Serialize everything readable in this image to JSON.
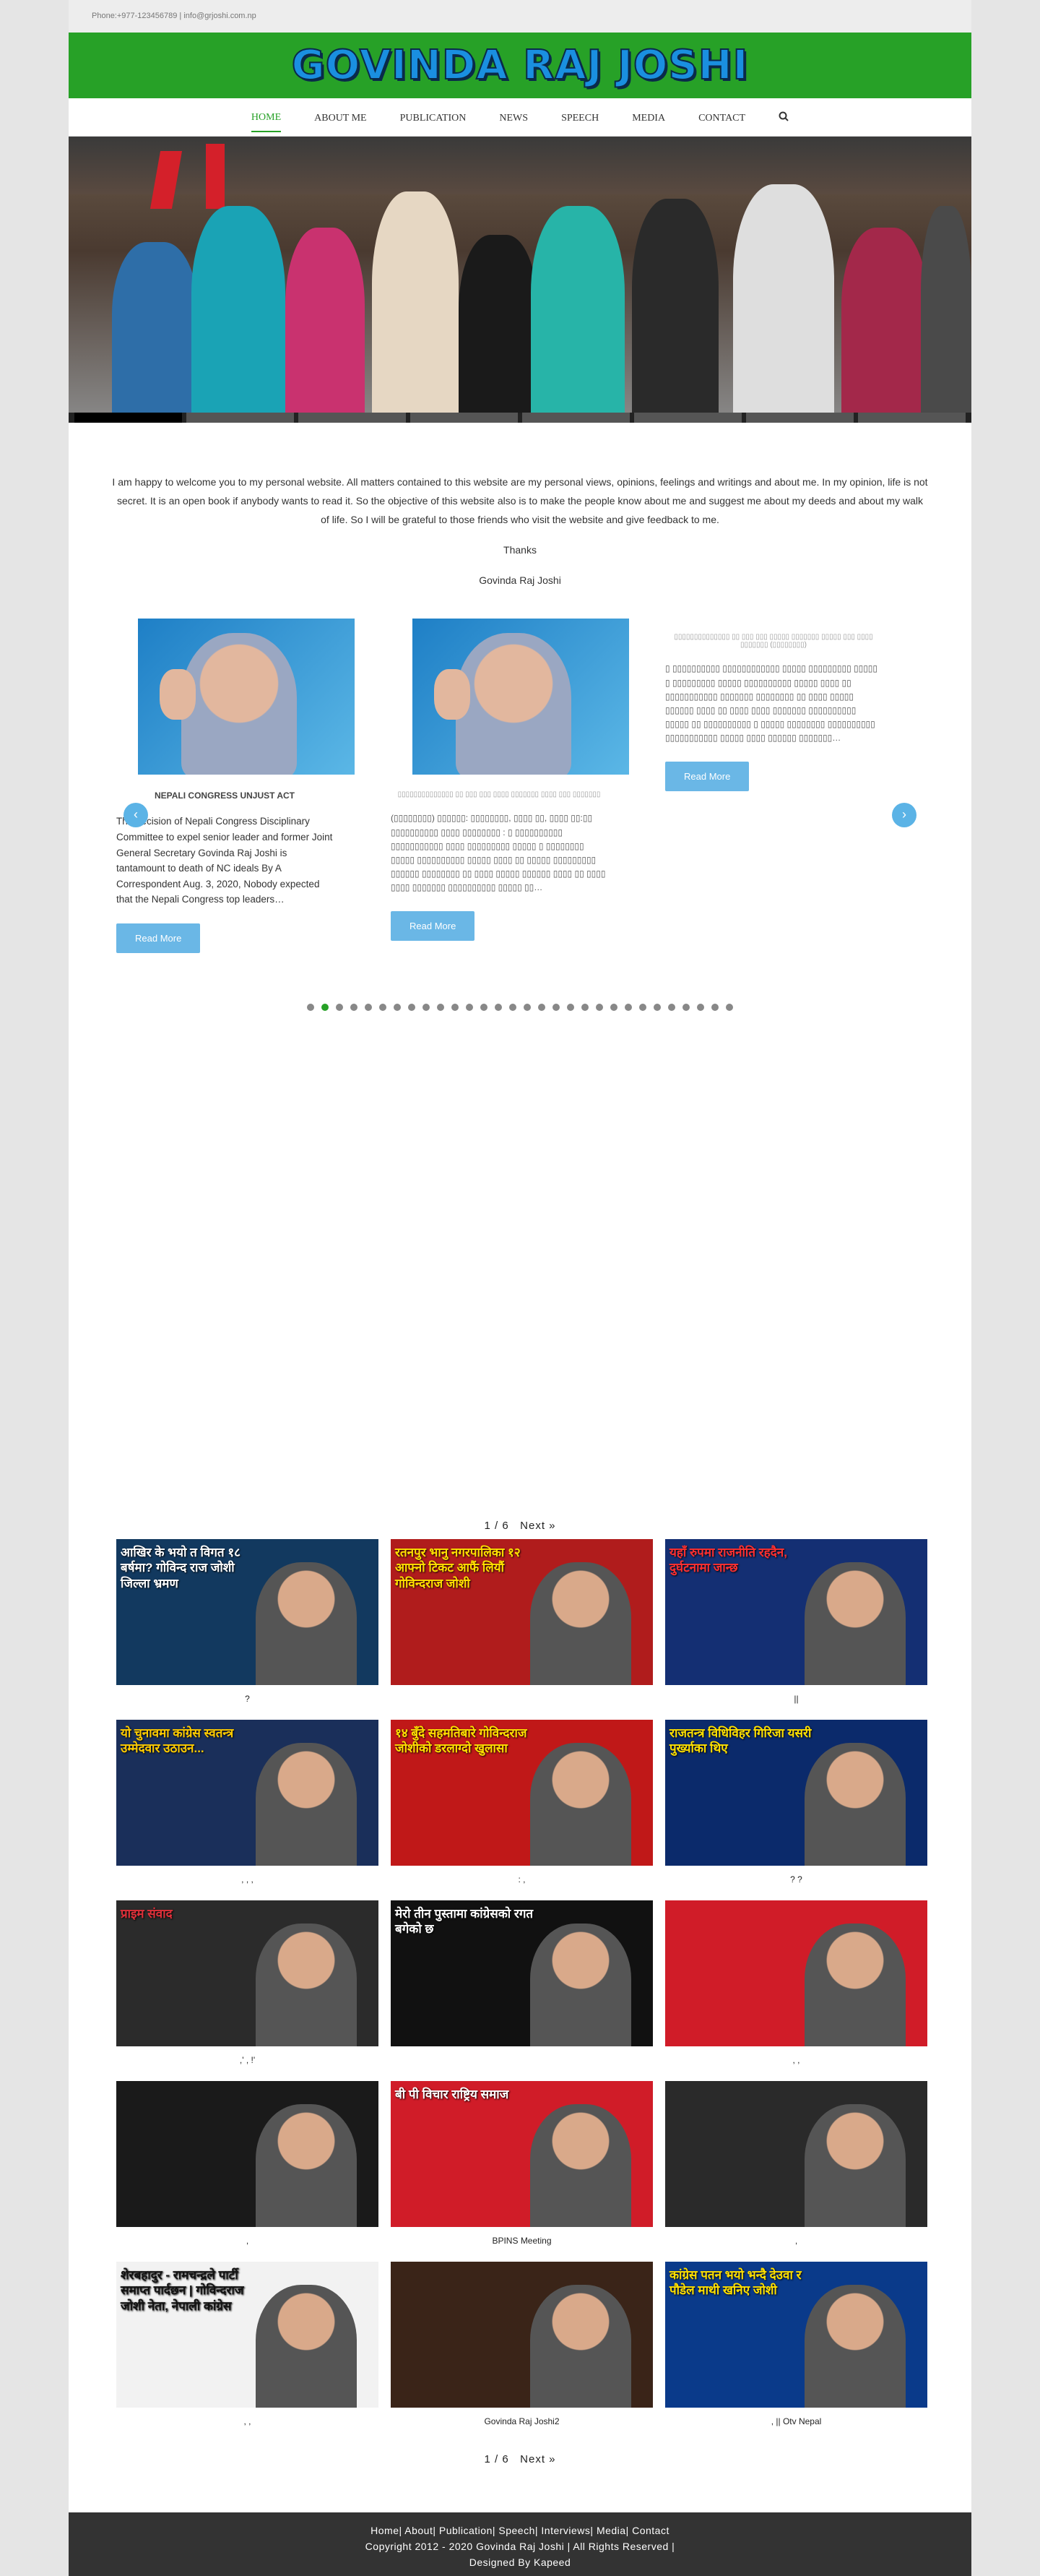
{
  "topbar": {
    "contact": "Phone:+977-123456789  |  info@grjoshi.com.np"
  },
  "header": {
    "logo_text": "GOVINDA RAJ JOSHI"
  },
  "nav": {
    "items": [
      "HOME",
      "ABOUT ME",
      "PUBLICATION",
      "NEWS",
      "SPEECH",
      "MEDIA",
      "CONTACT"
    ],
    "search_icon": "search-icon"
  },
  "intro": {
    "paragraph": "I am happy to welcome you to my personal website. All matters contained to this website are my personal views, opinions, feelings and writings and about me. In my opinion, life is not secret. It is an open book if anybody wants to read it. So the objective of this website also is to make the people know about me and suggest me about my deeds and about my walk of life. So I will be grateful to those friends who visit the website and give feedback to me.",
    "thanks": "Thanks",
    "signature": "Govinda Raj Joshi"
  },
  "carousel": {
    "cards": [
      {
        "title": "NEPALI CONGRESS UNJUST ACT",
        "text": "The decision of Nepali Congress Disciplinary Committee to expel senior leader and former Joint General Secretary Govinda Raj Joshi is tantamount to death of NC ideals By A Correspondent Aug. 3, 2020, Nobody expected that the Nepali Congress top leaders…",
        "button": "Read More"
      },
      {
        "title": "▯▯▯▯▯▯▯▯▯▯▯▯▯▯ ▯▯ ▯▯▯ ▯▯▯ ▯▯▯▯ ▯▯▯▯▯▯▯ ▯▯▯▯ ▯▯▯ ▯▯▯▯▯▯▯",
        "text": "(▯▯▯▯▯▯▯▯)     ▯▯▯▯▯▯: ▯▯▯▯▯▯▯▯, ▯▯▯▯ ▯▯, ▯▯▯▯  ▯▯:▯▯ ▯▯▯▯▯▯▯▯▯▯ ▯▯▯▯ ▯▯▯▯▯▯▯▯ : ▯ ▯▯▯▯▯▯▯▯▯▯ ▯▯▯▯▯▯▯▯▯▯▯ ▯▯▯▯ ▯▯▯▯▯▯▯▯▯ ▯▯▯▯▯ ▯ ▯▯▯▯▯▯▯▯ ▯▯▯▯▯ ▯▯▯▯▯▯▯▯▯▯ ▯▯▯▯▯ ▯▯▯▯ ▯▯ ▯▯▯▯▯ ▯▯▯▯▯▯▯▯▯ ▯▯▯▯▯▯ ▯▯▯▯▯▯▯▯ ▯▯ ▯▯▯▯ ▯▯▯▯▯ ▯▯▯▯▯▯ ▯▯▯▯ ▯▯ ▯▯▯▯ ▯▯▯▯ ▯▯▯▯▯▯▯ ▯▯▯▯▯▯▯▯▯▯ ▯▯▯▯▯ ▯▯…",
        "button": "Read More"
      },
      {
        "title": "▯▯▯▯▯▯▯▯▯▯▯▯▯▯ ▯▯ ▯▯▯ ▯▯▯ ▯▯▯▯▯ ▯▯▯▯▯▯▯ ▯▯▯▯▯ ▯▯▯ ▯▯▯▯ ▯▯▯▯▯▯▯ (▯▯▯▯▯▯▯▯)",
        "text": "▯ ▯▯▯▯▯▯▯▯▯▯ ▯▯▯▯▯▯▯▯▯▯▯▯ ▯▯▯▯▯ ▯▯▯▯▯▯▯▯▯ ▯▯▯▯▯ ▯ ▯▯▯▯▯▯▯▯▯ ▯▯▯▯▯ ▯▯▯▯▯▯▯▯▯▯ ▯▯▯▯▯ ▯▯▯▯ ▯▯ ▯▯▯▯▯▯▯▯▯▯▯ ▯▯▯▯▯▯▯ ▯▯▯▯▯▯▯▯ ▯▯ ▯▯▯▯ ▯▯▯▯▯ ▯▯▯▯▯▯ ▯▯▯▯ ▯▯ ▯▯▯▯ ▯▯▯▯ ▯▯▯▯▯▯▯ ▯▯▯▯▯▯▯▯▯▯ ▯▯▯▯▯ ▯▯ ▯▯▯▯▯▯▯▯▯▯ ▯ ▯▯▯▯▯ ▯▯▯▯▯▯▯▯ ▯▯▯▯▯▯▯▯▯▯ ▯▯▯▯▯▯▯▯▯▯▯ ▯▯▯▯▯ ▯▯▯▯ ▯▯▯▯▯▯ ▯▯▯▯▯▯▯…",
        "button": "Read More"
      }
    ],
    "prev_icon": "chevron-left-icon",
    "next_icon": "chevron-right-icon",
    "dots_total": 30,
    "dots_active": 2
  },
  "pagination": {
    "page": "1 / 6",
    "next": "Next »"
  },
  "videos": [
    {
      "caption": "?",
      "overlay": "आखिर के भयो त विगत १८ बर्षमा? गोविन्द राज जोशी जिल्ला भ्रमण",
      "bg": "#12395f",
      "accent": "#ffffff"
    },
    {
      "caption": "",
      "overlay": "रतनपुर भानु नगरपालिका १२ आफ्नो टिकट आफैं लियौं गोविन्दराज जोशी",
      "bg": "#b01c1c",
      "accent": "#ffe000"
    },
    {
      "caption": "||",
      "overlay": "यहाँ रुपमा राजनीति रहदैन, दुर्घटनामा जान्छ",
      "bg": "#142f73",
      "accent": "#ff3030"
    },
    {
      "caption": ",    ,    ,",
      "overlay": "यो चुनावमा कांग्रेस स्वतन्त्र उम्मेदवार उठाउन...",
      "bg": "#1a2f5a",
      "accent": "#ffcc00"
    },
    {
      "caption": ":    ,",
      "overlay": "१४ बुँदे सहमतिबारे गोविन्दराज जोशीको डरलाग्दो खुलासा",
      "bg": "#c01818",
      "accent": "#ffe000"
    },
    {
      "caption": "?           ?",
      "overlay": "राजतन्त्र विधिविहर गिरिजा यसरी पुर्ख्याका थिए",
      "bg": "#0b2a6b",
      "accent": "#ffe000"
    },
    {
      "caption": ",'          ,         !'",
      "overlay": "प्राइम संवाद",
      "bg": "#2b2b2b",
      "accent": "#e0303a"
    },
    {
      "caption": "",
      "overlay": "मेरो तीन पुस्तामा कांग्रेसको रगत बगेको छ",
      "bg": "#111111",
      "accent": "#ffffff"
    },
    {
      "caption": ",         ,",
      "overlay": "",
      "bg": "#d01c28",
      "accent": "#ffffff"
    },
    {
      "caption": ",",
      "overlay": "",
      "bg": "#1a1a1a",
      "accent": "#ffffff"
    },
    {
      "caption": "BPINS Meeting",
      "overlay": "बी पी विचार राष्ट्रिय समाज",
      "bg": "#d01c28",
      "accent": "#ffffff"
    },
    {
      "caption": ",",
      "overlay": "",
      "bg": "#2a2a2a",
      "accent": "#ffffff"
    },
    {
      "caption": ",        ,",
      "overlay": "शेरबहादुर - रामचन्द्रले पार्टी समाप्त पार्दछन | गोविन्दराज जोशी नेता, नेपाली कांग्रेस",
      "bg": "#f2f2f2",
      "accent": "#111111"
    },
    {
      "caption": "Govinda Raj Joshi2",
      "overlay": "",
      "bg": "#3a2418",
      "accent": "#ffffff"
    },
    {
      "caption": ",                   || Otv Nepal",
      "overlay": "कांग्रेस पतन भयो भन्दै देउवा र पौडेल माथी खनिए जोशी",
      "bg": "#0a3a8a",
      "accent": "#ffe000"
    }
  ],
  "footer": {
    "links": "Home| About| Publication| Speech| Interviews| Media| Contact",
    "copyright": "Copyright 2012 - 2020 Govinda Raj Joshi | All Rights Reserved |",
    "credit": "Designed By Kapeed"
  }
}
